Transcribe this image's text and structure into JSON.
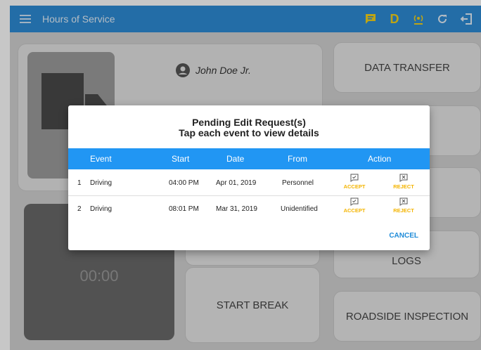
{
  "appbar": {
    "title": "Hours of Service",
    "d_label": "D"
  },
  "profile": {
    "driver_name": "John Doe Jr."
  },
  "tiles": {
    "data_transfer": "DATA TRANSFER",
    "logs": "LOGS",
    "start_break": "START BREAK",
    "roadside_inspection": "ROADSIDE INSPECTION",
    "timer": "00:00"
  },
  "dialog": {
    "title_line1": "Pending Edit Request(s)",
    "title_line2": "Tap each event to view details",
    "columns": {
      "event": "Event",
      "start": "Start",
      "date": "Date",
      "from": "From",
      "action": "Action"
    },
    "rows": [
      {
        "num": "1",
        "event": "Driving",
        "start": "04:00 PM",
        "date": "Apr 01, 2019",
        "from": "Personnel",
        "accept": "ACCEPT",
        "reject": "REJECT"
      },
      {
        "num": "2",
        "event": "Driving",
        "start": "08:01 PM",
        "date": "Mar 31, 2019",
        "from": "Unidentified",
        "accept": "ACCEPT",
        "reject": "REJECT"
      }
    ],
    "cancel": "CANCEL"
  },
  "colors": {
    "appbar": "#2e8cd6",
    "table_header": "#2196f3",
    "accent": "#f4b400",
    "cancel": "#1e8bd8"
  }
}
